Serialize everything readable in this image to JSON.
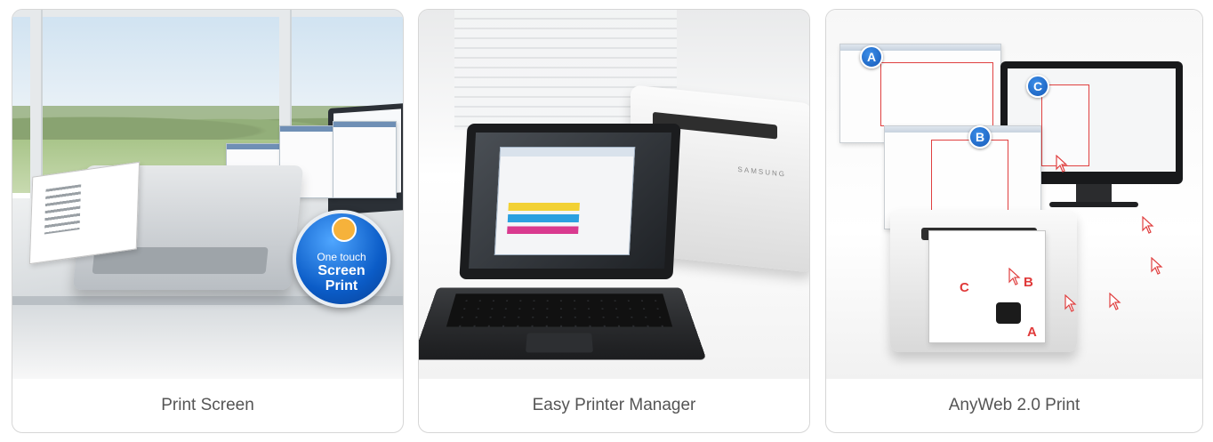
{
  "cards": [
    {
      "caption": "Print Screen",
      "badge": {
        "line1": "One touch",
        "line2": "Screen",
        "line3": "Print"
      }
    },
    {
      "caption": "Easy Printer Manager",
      "printer_brand": "SAMSUNG"
    },
    {
      "caption": "AnyWeb 2.0 Print",
      "markers": [
        "A",
        "B",
        "C"
      ]
    }
  ],
  "colors": {
    "card_border": "#d6d6d6",
    "caption_text": "#555555",
    "badge_blue": "#0b5cc7",
    "marker_blue": "#1559b8",
    "selection_red": "#e04040"
  },
  "icons": [
    "hand-tap-icon",
    "cursor-icon"
  ]
}
